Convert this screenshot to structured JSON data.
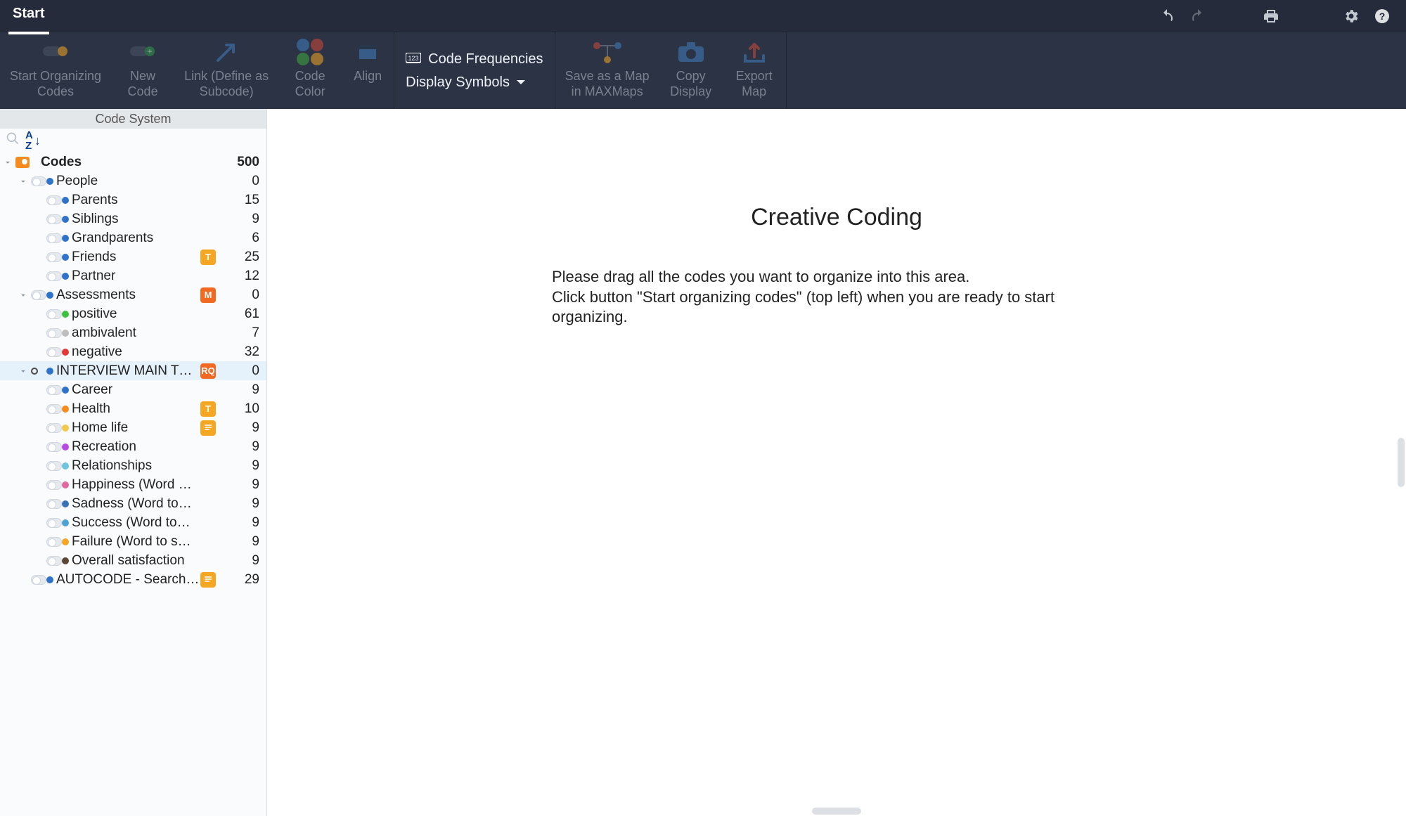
{
  "titlebar": {
    "title": "Start"
  },
  "ribbon": {
    "start_organizing": "Start Organizing\nCodes",
    "new_code": "New\nCode",
    "link_subcode": "Link (Define as\nSubcode)",
    "code_color": "Code\nColor",
    "align": "Align",
    "code_frequencies": "Code Frequencies",
    "display_symbols": "Display Symbols",
    "save_map": "Save as a Map\nin MAXMaps",
    "copy_display": "Copy\nDisplay",
    "export_map": "Export\nMap"
  },
  "sidebar": {
    "header": "Code System",
    "root": {
      "label": "Codes",
      "count": 500
    },
    "nodes": [
      {
        "label": "People",
        "count": 0,
        "dot": "#2e72c9",
        "expanded": true,
        "level": 1,
        "children": [
          {
            "label": "Parents",
            "count": 15,
            "dot": "#2e72c9",
            "level": 2
          },
          {
            "label": "Siblings",
            "count": 9,
            "dot": "#2e72c9",
            "level": 2
          },
          {
            "label": "Grandparents",
            "count": 6,
            "dot": "#2e72c9",
            "level": 2
          },
          {
            "label": "Friends",
            "count": 25,
            "dot": "#2e72c9",
            "level": 2,
            "badge": {
              "text": "T",
              "bg": "#f5a623"
            }
          },
          {
            "label": "Partner",
            "count": 12,
            "dot": "#2e72c9",
            "level": 2
          }
        ]
      },
      {
        "label": "Assessments",
        "count": 0,
        "dot": "#2e72c9",
        "expanded": true,
        "level": 1,
        "badge": {
          "text": "M",
          "bg": "#f26a21"
        },
        "children": [
          {
            "label": "positive",
            "count": 61,
            "dot": "#3fbf3f",
            "level": 2
          },
          {
            "label": "ambivalent",
            "count": 7,
            "dot": "#bdbdbd",
            "level": 2
          },
          {
            "label": "negative",
            "count": 32,
            "dot": "#e23838",
            "level": 2
          }
        ]
      },
      {
        "label": "INTERVIEW MAIN TO…",
        "count": 0,
        "dot": "#2e72c9",
        "expanded": true,
        "level": 1,
        "selected": true,
        "ring": true,
        "badge": {
          "text": "RQ",
          "bg": "#f26a21"
        },
        "children": [
          {
            "label": "Career",
            "count": 9,
            "dot": "#2e72c9",
            "level": 2
          },
          {
            "label": "Health",
            "count": 10,
            "dot": "#f58a1f",
            "level": 2,
            "badge": {
              "text": "T",
              "bg": "#f5a623"
            }
          },
          {
            "label": "Home life",
            "count": 9,
            "dot": "#f2c94c",
            "level": 2,
            "badge": {
              "text": "",
              "bg": "#f5a623",
              "memo": true
            }
          },
          {
            "label": "Recreation",
            "count": 9,
            "dot": "#b84be0",
            "level": 2
          },
          {
            "label": "Relationships",
            "count": 9,
            "dot": "#6ec3e0",
            "level": 2
          },
          {
            "label": "Happiness (Word …",
            "count": 9,
            "dot": "#e06aa0",
            "level": 2
          },
          {
            "label": "Sadness (Word to…",
            "count": 9,
            "dot": "#3a73b5",
            "level": 2
          },
          {
            "label": "Success (Word to…",
            "count": 9,
            "dot": "#4aa3d1",
            "level": 2
          },
          {
            "label": "Failure (Word to s…",
            "count": 9,
            "dot": "#f5a623",
            "level": 2
          },
          {
            "label": "Overall satisfaction",
            "count": 9,
            "dot": "#5b4636",
            "level": 2
          }
        ]
      },
      {
        "label": "AUTOCODE - Search…",
        "count": 29,
        "dot": "#2e72c9",
        "level": 1,
        "badge": {
          "text": "",
          "bg": "#f5a623",
          "memo": true
        }
      }
    ]
  },
  "canvas": {
    "title": "Creative Coding",
    "hint": "Please drag all the codes you want to organize into this area.\nClick button \"Start organizing codes\" (top left) when you are ready to start organizing."
  }
}
